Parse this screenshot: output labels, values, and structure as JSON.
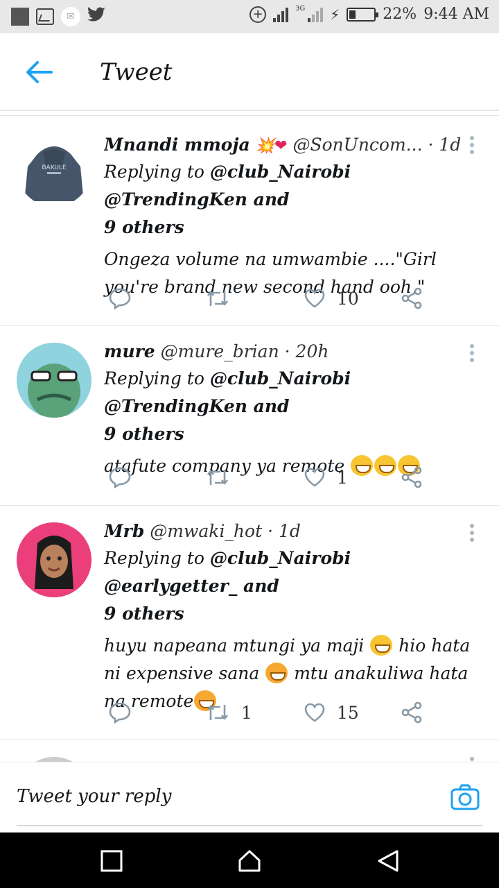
{
  "status_bar": {
    "battery": "22%",
    "time": "9:44 AM",
    "network": "3G"
  },
  "header": {
    "title": "Tweet"
  },
  "tweets": [
    {
      "name": "Mnandi mmoja",
      "name_emoji": "💥❤",
      "handle": "@SonUncom...",
      "time": "· 1d",
      "replying_prefix": "Replying to ",
      "mentions": "@club_Nairobi @TrendingKen and",
      "others": "9 others",
      "text": "Ongeza volume na umwambie ....\"Girl you're brand new second hand ooh,\"",
      "retweets": "",
      "likes": "10",
      "avatar_text": "BAKULE"
    },
    {
      "name": "mure",
      "handle": "@mure_brian",
      "time": "· 20h",
      "replying_prefix": "Replying to ",
      "mentions": "@club_Nairobi @TrendingKen and",
      "others": "9 others",
      "text": "atafute company ya remote",
      "retweets": "",
      "likes": "1"
    },
    {
      "name": "Mrb",
      "handle": "@mwaki_hot",
      "time": "· 1d",
      "replying_prefix": "Replying to ",
      "mentions": "@club_Nairobi @earlygetter_ and",
      "others": "9 others",
      "text_1": "huyu napeana mtungi ya maji",
      "text_2": "hio hata ni expensive sana",
      "text_3": "mtu anakuliwa hata na remote",
      "retweets": "1",
      "likes": "15"
    }
  ],
  "reply_bar": {
    "placeholder": "Tweet your reply"
  },
  "colors": {
    "accent": "#1da1f2",
    "icon_gray": "#8899a6",
    "divider": "#e1e8ed"
  }
}
